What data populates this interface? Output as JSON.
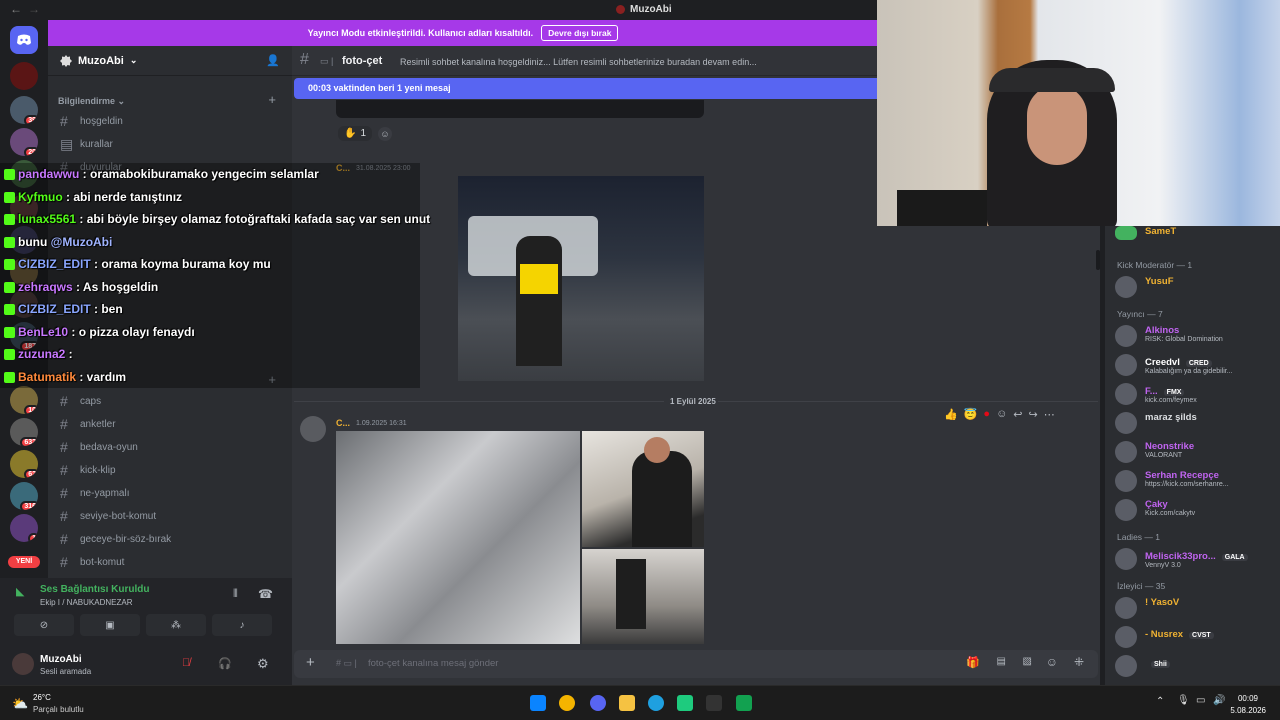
{
  "window": {
    "title": "MuzoAbi"
  },
  "banner": {
    "text": "Yayıncı Modu etkinleştirildi. Kullanıcı adları kısaltıldı.",
    "button": "Devre dışı bırak"
  },
  "server": {
    "name": "MuzoAbi"
  },
  "rail_badges": [
    "39",
    "20",
    "187",
    "10",
    "632",
    "62",
    "316",
    "1"
  ],
  "rail_new": "YENİ",
  "channels": {
    "category": "Bilgilendirme",
    "items": [
      {
        "label": "hoşgeldin"
      },
      {
        "label": "kurallar"
      },
      {
        "label": "duyurular"
      },
      {
        "label": "caps"
      },
      {
        "label": "anketler"
      },
      {
        "label": "bedava-oyun"
      },
      {
        "label": "kick-klip"
      },
      {
        "label": "ne-yapmalı"
      },
      {
        "label": "seviye-bot-komut"
      },
      {
        "label": "geceye-bir-söz-bırak"
      },
      {
        "label": "bot-komut"
      }
    ]
  },
  "voice": {
    "status": "Ses Bağlantısı Kuruldu",
    "channel": "Ekip I / NABUKADNEZAR"
  },
  "user": {
    "name": "MuzoAbi",
    "status": "Sesli aramada"
  },
  "chat": {
    "channel": "foto-çet",
    "topic": "Resimli sohbet kanalına hoşgeldiniz... Lütfen resimli sohbetlerinize buradan devam edin...",
    "new_messages": "00:03 vaktinden beri 1 yeni mesaj",
    "reaction_count": "1",
    "msg1": {
      "author": "C...",
      "time": "31.08.2025 23:00"
    },
    "date_divider": "1 Eylül 2025",
    "msg2": {
      "author": "C...",
      "time": "1.09.2025 16:31"
    },
    "composer_placeholder": "foto-çet kanalına mesaj gönder"
  },
  "members": {
    "top": {
      "name": "SameT"
    },
    "groups": [
      {
        "title": "Kick Moderatör — 1",
        "members": [
          {
            "name": "YusuF",
            "sub": "",
            "color": "#f0b232"
          }
        ]
      },
      {
        "title": "Yayıncı — 7",
        "members": [
          {
            "name": "Alkinos",
            "sub": "RISK: Global Domination",
            "color": "#c064f0"
          },
          {
            "name": "Creedvl",
            "sub": "Kalabalığım ya da gidebilir...",
            "color": "#ffffff",
            "tag": "CRED"
          },
          {
            "name": "F...",
            "sub": "kick.com/feymex",
            "color": "#c064f0",
            "tag": "FMX"
          },
          {
            "name": "maraz şilds",
            "sub": "",
            "color": "#dbdee1"
          },
          {
            "name": "Neonstrike",
            "sub": "VALORANT",
            "color": "#c064f0"
          },
          {
            "name": "Serhan Recepçe",
            "sub": "https://kick.com/serhanre...",
            "color": "#c064f0"
          },
          {
            "name": "Çaky",
            "sub": "Kick.com/cakytv",
            "color": "#c064f0"
          }
        ]
      },
      {
        "title": "Ladies — 1",
        "members": [
          {
            "name": "Meliscik33pro...",
            "sub": "VennyV 3.0",
            "color": "#c064f0",
            "tag": "GALA"
          }
        ]
      },
      {
        "title": "İzleyici — 35",
        "members": [
          {
            "name": "! YasoV",
            "sub": "",
            "color": "#f0b232"
          },
          {
            "name": "- Nusrex",
            "sub": "",
            "color": "#f0b232",
            "tag": "CVST"
          },
          {
            "name": "",
            "sub": "",
            "color": "#f0b232",
            "tag": "Shii"
          }
        ]
      }
    ]
  },
  "overlay": [
    {
      "user": "pandawwu",
      "text": " : oramabokiburamako yengecim selamlar",
      "color": "#c878ff"
    },
    {
      "user": "Kyfmuo",
      "text": " : abi nerde tanıştınız",
      "color": "#53fc18"
    },
    {
      "user": "lunax5561",
      "text": " : abi böyle birşey olamaz fotoğraftaki kafada saç var sen unut",
      "color": "#53fc18"
    },
    {
      "user": "bunu",
      "text": " @MuzoAbi",
      "color": "#ffffff",
      "mention": true
    },
    {
      "user": "CIZBIZ_EDIT",
      "text": " : orama koyma burama koy mu",
      "color": "#8aa6ff"
    },
    {
      "user": "zehraqws",
      "text": " : As hoşgeldin",
      "color": "#c878ff"
    },
    {
      "user": "CIZBIZ_EDIT",
      "text": " : ben",
      "color": "#8aa6ff"
    },
    {
      "user": "BenLe10",
      "text": " : o pizza olayı fenaydı",
      "color": "#c878ff"
    },
    {
      "user": "zuzuna2",
      "text": " :",
      "color": "#c878ff"
    },
    {
      "user": "Batumatik",
      "text": " : vardım",
      "color": "#ff8a3c"
    }
  ],
  "taskbar": {
    "temp": "26°C",
    "weather": "Parçalı bulutlu",
    "time": "00:09",
    "date": "5.08.2026"
  }
}
